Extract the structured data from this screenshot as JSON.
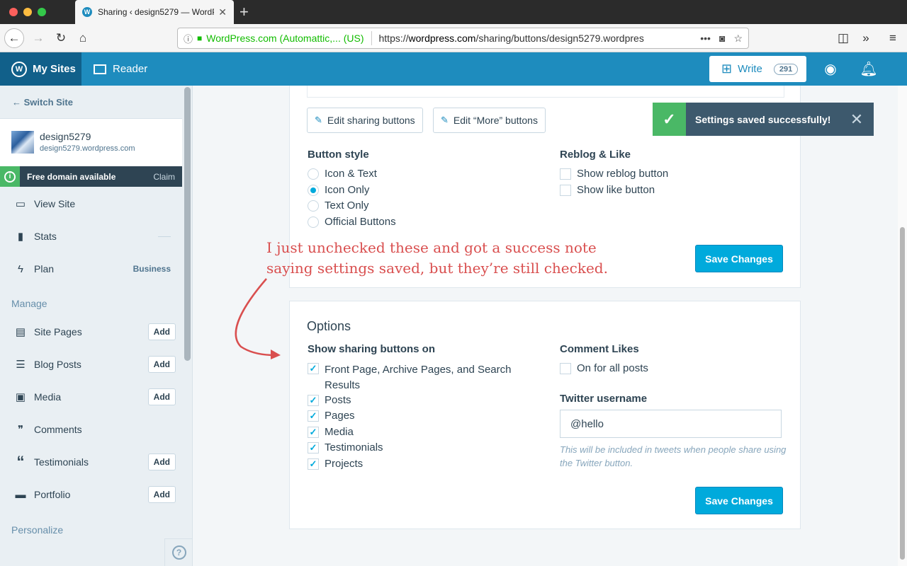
{
  "browser": {
    "tab_title": "Sharing ‹ design5279 — WordP",
    "tab_favicon": "W",
    "url_identity": "WordPress.com (Automattic,... (US)",
    "url_prefix": "https://",
    "url_domain": "wordpress.com",
    "url_path": "/sharing/buttons/design5279.wordpres"
  },
  "masterbar": {
    "my_sites": "My Sites",
    "reader": "Reader",
    "write": "Write",
    "write_count": "291"
  },
  "sidebar": {
    "switch_site": "Switch Site",
    "site_name": "design5279",
    "site_url": "design5279.wordpress.com",
    "domain_banner": "Free domain available",
    "domain_claim": "Claim",
    "items": [
      {
        "label": "View Site"
      },
      {
        "label": "Stats"
      },
      {
        "label": "Plan",
        "badge": "Business"
      }
    ],
    "manage_heading": "Manage",
    "manage_items": [
      {
        "label": "Site Pages",
        "add": "Add"
      },
      {
        "label": "Blog Posts",
        "add": "Add"
      },
      {
        "label": "Media",
        "add": "Add"
      },
      {
        "label": "Comments"
      },
      {
        "label": "Testimonials",
        "add": "Add"
      },
      {
        "label": "Portfolio",
        "add": "Add"
      }
    ],
    "personalize_heading": "Personalize",
    "help": "?"
  },
  "buttons_card": {
    "edit_sharing": "Edit sharing buttons",
    "edit_more": "Edit “More” buttons",
    "button_style_label": "Button style",
    "button_styles": [
      "Icon & Text",
      "Icon Only",
      "Text Only",
      "Official Buttons"
    ],
    "button_style_selected": "Icon Only",
    "reblog_like_label": "Reblog & Like",
    "reblog_like_options": [
      "Show reblog button",
      "Show like button"
    ],
    "save": "Save Changes"
  },
  "options_card": {
    "title": "Options",
    "show_on_label": "Show sharing buttons on",
    "show_on_options": [
      {
        "label": "Front Page, Archive Pages, and Search",
        "label2": "Results",
        "checked": true
      },
      {
        "label": "Posts",
        "checked": true
      },
      {
        "label": "Pages",
        "checked": true
      },
      {
        "label": "Media",
        "checked": true
      },
      {
        "label": "Testimonials",
        "checked": true
      },
      {
        "label": "Projects",
        "checked": true
      }
    ],
    "comment_likes_label": "Comment Likes",
    "comment_likes_option": "On for all posts",
    "twitter_label": "Twitter username",
    "twitter_value": "@hello",
    "twitter_help": "This will be included in tweets when people share using the Twitter button.",
    "save": "Save Changes"
  },
  "notice": {
    "text": "Settings saved successfully!"
  },
  "annotation": {
    "line1": "I just unchecked these and got a success note",
    "line2": "saying settings saved, but they’re still checked."
  },
  "colors": {
    "wp_blue": "#1e8cbe",
    "accent": "#00aadc",
    "success": "#4ab866",
    "annotation_red": "#d94f4f"
  }
}
